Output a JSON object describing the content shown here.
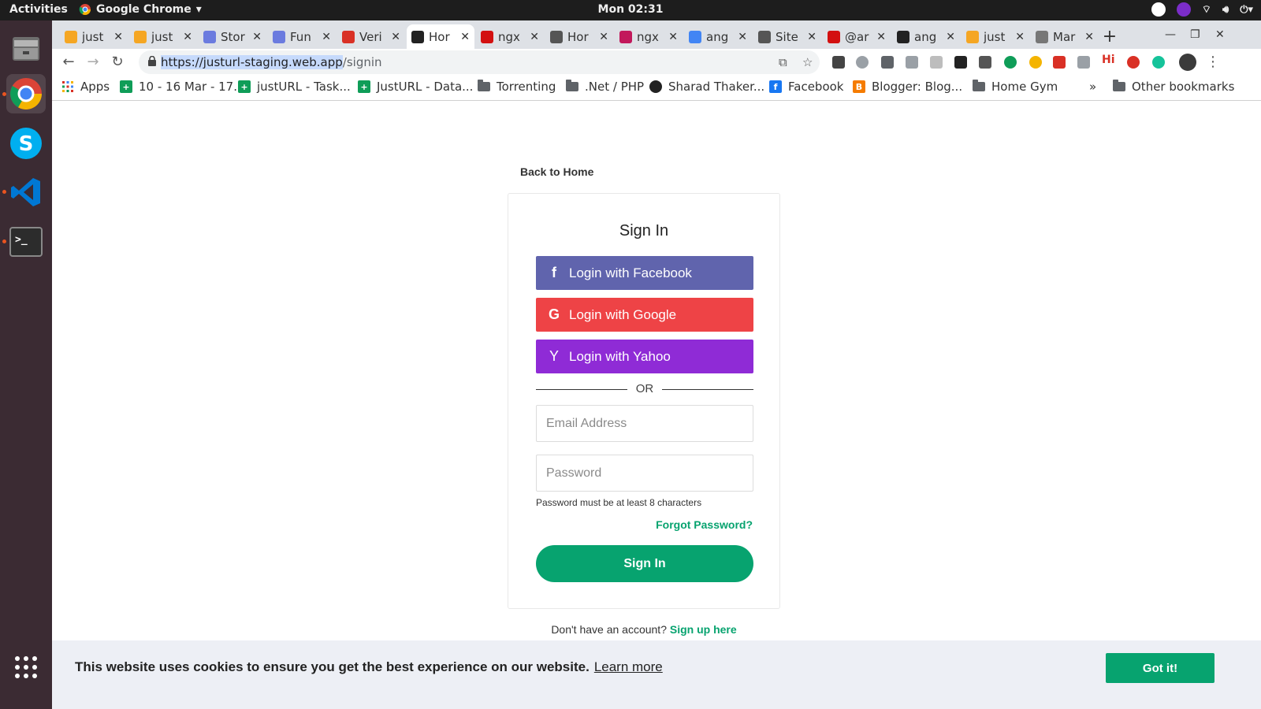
{
  "system_bar": {
    "activities": "Activities",
    "app_name": "Google Chrome",
    "clock": "Mon 02:31"
  },
  "dock": {
    "apps": [
      "files-icon",
      "chrome-icon",
      "skype-icon",
      "vscode-icon",
      "terminal-icon",
      "show-apps-icon"
    ]
  },
  "tabs": [
    {
      "label": "just",
      "favicon_color": "#f5a623"
    },
    {
      "label": "just",
      "favicon_color": "#f5a623"
    },
    {
      "label": "Stor",
      "favicon_color": "#6b7bdf"
    },
    {
      "label": "Fun",
      "favicon_color": "#6b7bdf"
    },
    {
      "label": "Veri",
      "favicon_color": "#d93025"
    },
    {
      "label": "Hor",
      "favicon_color": "#222222"
    },
    {
      "label": "ngx",
      "favicon_color": "#d31010"
    },
    {
      "label": "Hor",
      "favicon_color": "#555555"
    },
    {
      "label": "ngx",
      "favicon_color": "#c2185b"
    },
    {
      "label": "ang",
      "favicon_color": "#4285f4"
    },
    {
      "label": "Site",
      "favicon_color": "#555555"
    },
    {
      "label": "@ar",
      "favicon_color": "#d31010"
    },
    {
      "label": "ang",
      "favicon_color": "#222222"
    },
    {
      "label": "just",
      "favicon_color": "#f5a623"
    },
    {
      "label": "Mar",
      "favicon_color": "#777777"
    }
  ],
  "omnibox": {
    "url_selected": "https://justurl-staging.web.app",
    "url_path": "/signin"
  },
  "bookmarks": [
    {
      "label": "Apps",
      "icon": "apps-grid-icon"
    },
    {
      "label": "10 - 16 Mar - 17...",
      "icon": "sheets-icon"
    },
    {
      "label": "justURL - Task...",
      "icon": "sheets-icon"
    },
    {
      "label": "JustURL - Data...",
      "icon": "sheets-icon"
    },
    {
      "label": "Torrenting",
      "icon": "folder-icon"
    },
    {
      "label": ".Net / PHP",
      "icon": "folder-icon"
    },
    {
      "label": "Sharad Thaker...",
      "icon": "site-icon"
    },
    {
      "label": "Facebook",
      "icon": "facebook-icon"
    },
    {
      "label": "Blogger: Blog...",
      "icon": "blogger-icon"
    },
    {
      "label": "Home Gym",
      "icon": "folder-icon"
    }
  ],
  "bookmarks_more": "»",
  "other_bookmarks": "Other bookmarks",
  "page": {
    "back_link": "Back to Home",
    "title": "Sign In",
    "facebook_btn": "Login with Facebook",
    "google_btn": "Login with Google",
    "yahoo_btn": "Login with Yahoo",
    "or": "OR",
    "email_placeholder": "Email Address",
    "password_placeholder": "Password",
    "password_hint": "Password must be at least 8 characters",
    "forgot": "Forgot Password?",
    "signin_btn": "Sign In",
    "no_account": "Don't have an account?",
    "signup_link": "Sign up here"
  },
  "cookie": {
    "message": "This website uses cookies to ensure you get the best experience on our website.",
    "learn_more": "Learn more",
    "accept": "Got it!"
  },
  "colors": {
    "facebook": "#6064ad",
    "google": "#ee4346",
    "yahoo": "#8f2bd6",
    "primary": "#07a36f"
  }
}
